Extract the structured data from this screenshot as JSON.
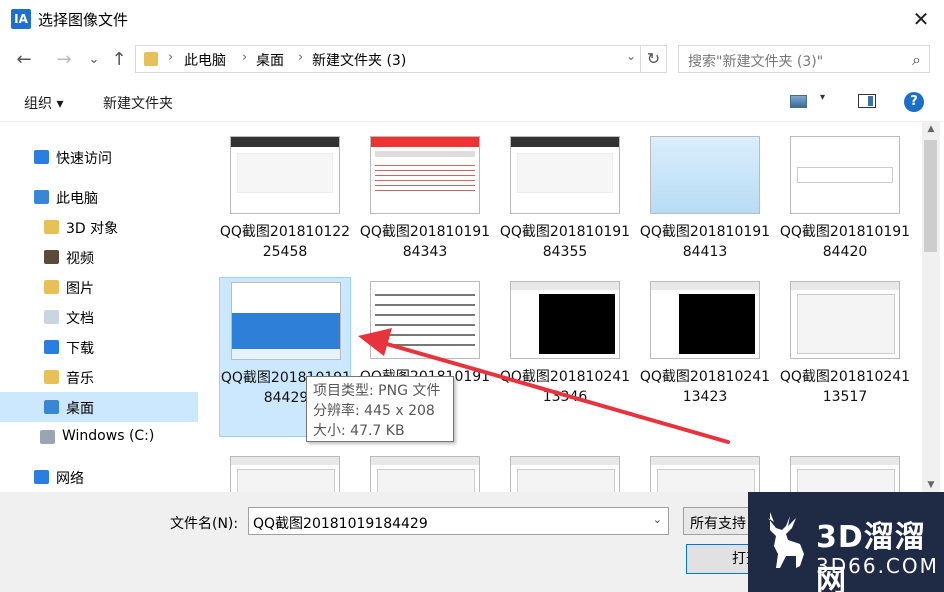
{
  "window": {
    "title": "选择图像文件",
    "close_glyph": "✕"
  },
  "nav": {
    "back": "←",
    "forward": "→",
    "recent": "⌄",
    "up": "↑",
    "breadcrumb": [
      "此电脑",
      "桌面",
      "新建文件夹 (3)"
    ],
    "separator": "›",
    "refresh": "↻",
    "search_placeholder": "搜索\"新建文件夹 (3)\"",
    "search_icon": "⌕"
  },
  "toolbar": {
    "organize": "组织 ▾",
    "new_folder": "新建文件夹",
    "help": "?"
  },
  "sidebar": {
    "items": [
      {
        "label": "快速访问",
        "icon": "star-icon",
        "color": "#2a7de1"
      },
      {
        "label": "此电脑",
        "icon": "computer-icon",
        "color": "#3a86d6"
      },
      {
        "label": "3D 对象",
        "icon": "3d-objects-icon",
        "color": "#e8c05a"
      },
      {
        "label": "视频",
        "icon": "video-icon",
        "color": "#5b4a3a"
      },
      {
        "label": "图片",
        "icon": "pictures-icon",
        "color": "#e8c05a"
      },
      {
        "label": "文档",
        "icon": "documents-icon",
        "color": "#c9d5e0"
      },
      {
        "label": "下载",
        "icon": "download-icon",
        "color": "#2a7de1"
      },
      {
        "label": "音乐",
        "icon": "music-icon",
        "color": "#e8c05a"
      },
      {
        "label": "桌面",
        "icon": "desktop-icon",
        "color": "#3a86d6"
      },
      {
        "label": "Windows (C:)",
        "icon": "drive-icon",
        "color": "#9aa5b1"
      },
      {
        "label": "网络",
        "icon": "network-icon",
        "color": "#2a7de1"
      }
    ]
  },
  "files": [
    {
      "name": "QQ截图20181012225458",
      "thumb": "light"
    },
    {
      "name": "QQ截图20181019184343",
      "thumb": "web"
    },
    {
      "name": "QQ截图20181019184355",
      "thumb": "light"
    },
    {
      "name": "QQ截图20181019184413",
      "thumb": "blue"
    },
    {
      "name": "QQ截图20181019184420",
      "thumb": "form"
    },
    {
      "name": "QQ截图20181019184429",
      "thumb": "app",
      "selected": true
    },
    {
      "name": "QQ截图20181019184",
      "thumb": "text"
    },
    {
      "name": "QQ截图20181024113346",
      "thumb": "cad-dark"
    },
    {
      "name": "QQ截图20181024113423",
      "thumb": "cad-dark"
    },
    {
      "name": "QQ截图20181024113517",
      "thumb": "cad-light"
    },
    {
      "name": "",
      "thumb": "cad-light"
    },
    {
      "name": "",
      "thumb": "cad-light"
    },
    {
      "name": "",
      "thumb": "cad-light"
    },
    {
      "name": "",
      "thumb": "cad-light"
    },
    {
      "name": "",
      "thumb": "cad-light"
    }
  ],
  "tooltip": {
    "line1": "项目类型: PNG 文件",
    "line2": "分辨率: 445 x 208",
    "line3": "大小: 47.7 KB"
  },
  "bottom": {
    "filename_label": "文件名(N):",
    "filename_value": "QQ截图20181019184429",
    "filetype": "所有支持",
    "open": "打开"
  },
  "watermark": {
    "brand": "3D溜溜网",
    "domain": "3D66.COM"
  },
  "colors": {
    "selection": "#cce8ff",
    "arrow": "#e8323c",
    "accent": "#0078d7"
  }
}
